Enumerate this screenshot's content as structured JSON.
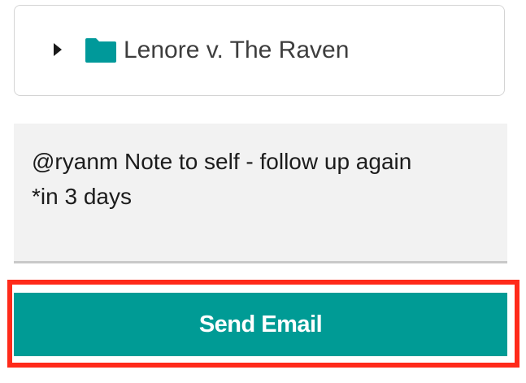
{
  "matter": {
    "name": "Lenore v. The Raven",
    "folder_icon": "folder-icon",
    "toggle_icon": "caret-right-icon",
    "folder_color": "#00999a"
  },
  "note": {
    "text": "@ryanm Note to self - follow up again\n*in 3 days"
  },
  "actions": {
    "send_email_label": "Send Email",
    "button_color": "#009b95",
    "highlight_color": "#ff2a1a"
  }
}
